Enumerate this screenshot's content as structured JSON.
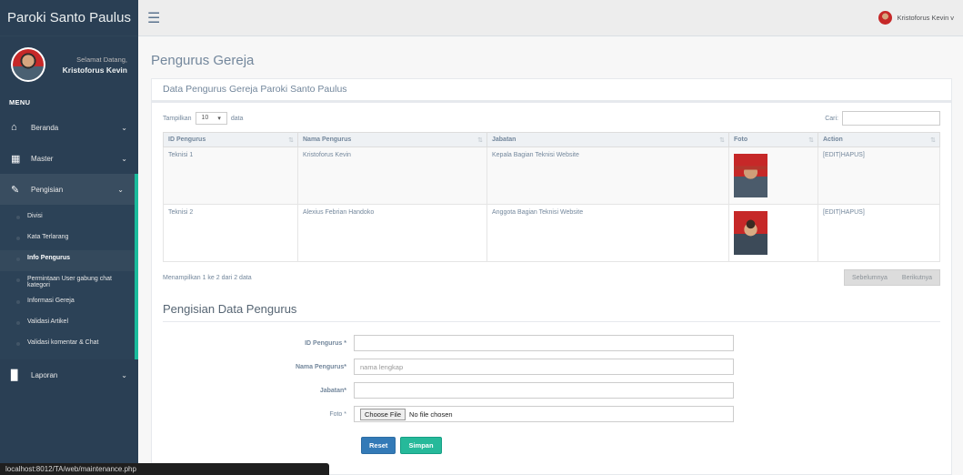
{
  "app": {
    "brand": "Paroki Santo Paulus"
  },
  "profile": {
    "greeting": "Selamat Datang,",
    "name": "Kristoforus Kevin"
  },
  "sidebar": {
    "menu_title": "MENU",
    "items": [
      {
        "label": "Beranda",
        "icon": "home-icon"
      },
      {
        "label": "Master",
        "icon": "table-icon"
      },
      {
        "label": "Pengisian",
        "icon": "edit-icon"
      },
      {
        "label": "Laporan",
        "icon": "bar-chart-icon"
      }
    ],
    "submenu": [
      "Divisi",
      "Kata Terlarang",
      "Info Pengurus",
      "Permintaan User gabung chat kategori",
      "Informasi Gereja",
      "Validasi Artikel",
      "Validasi komentar & Chat"
    ]
  },
  "topbar": {
    "user": "Kristoforus Kevin",
    "caret": "v"
  },
  "page": {
    "title": "Pengurus Gereja",
    "panel_title": "Data Pengurus Gereja Paroki Santo Paulus"
  },
  "datatable": {
    "show_label": "Tampilkan",
    "length_value": "10",
    "length_caret": "▾",
    "data_label": "data",
    "search_label": "Cari:",
    "columns": [
      "ID Pengurus",
      "Nama Pengurus",
      "Jabatan",
      "Foto",
      "Action"
    ],
    "rows": [
      {
        "id": "Teknisi 1",
        "nama": "Kristoforus Kevin",
        "jabatan": "Kepala Bagian Teknisi Website",
        "action": "[EDIT|HAPUS]"
      },
      {
        "id": "Teknisi 2",
        "nama": "Alexius Febrian Handoko",
        "jabatan": "Anggota Bagian Teknisi Website",
        "action": "[EDIT|HAPUS]"
      }
    ],
    "info": "Menampilkan 1 ke 2 dari 2 data",
    "prev": "Sebelumnya",
    "next": "Berikutnya"
  },
  "form": {
    "title": "Pengisian Data Pengurus",
    "id_label": "ID Pengurus *",
    "nama_label": "Nama Pengurus*",
    "nama_placeholder": "nama lengkap",
    "jabatan_label": "Jabatan*",
    "foto_label": "Foto *",
    "choose_file": "Choose File",
    "no_file": "No file chosen",
    "reset": "Reset",
    "simpan": "Simpan"
  },
  "statusbar": {
    "url": "localhost:8012/TA/web/maintenance.php"
  },
  "colors": {
    "sidebar": "#2a3f54",
    "accent": "#1abb9c",
    "primary": "#337ab7",
    "success": "#26b99a"
  }
}
